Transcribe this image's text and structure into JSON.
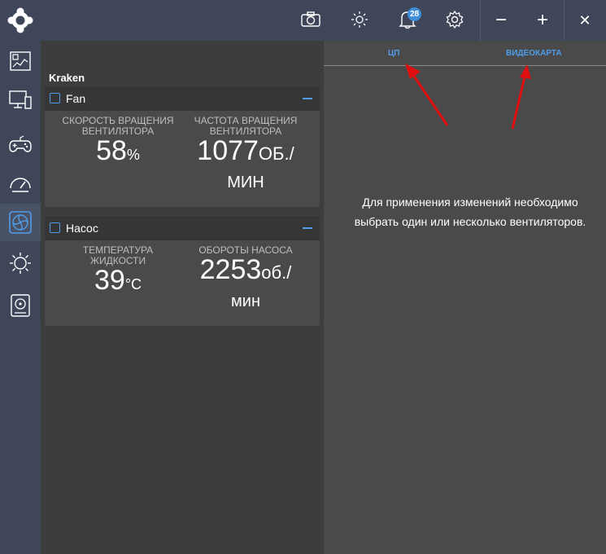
{
  "topbar": {
    "icons": [
      "camera-icon",
      "sun-icon",
      "bell-icon",
      "gear-icon"
    ],
    "notification_count": "28",
    "minimize_label": "−",
    "maximize_label": "+",
    "close_label": "✕"
  },
  "sidebar": {
    "items": [
      "dashboard-icon",
      "monitor-icon",
      "gamepad-icon",
      "speedometer-icon",
      "fan-icon",
      "lighting-icon",
      "storage-icon"
    ],
    "active_index": 4
  },
  "device": {
    "name": "Kraken",
    "fan_card": {
      "title": "Fan",
      "speed_label": "СКОРОСТЬ ВРАЩЕНИЯ ВЕНТИЛЯТОРА",
      "speed_value": "58",
      "speed_unit": "%",
      "rpm_label": "ЧАСТОТА ВРАЩЕНИЯ ВЕНТИЛЯТОРА",
      "rpm_value": "1077",
      "rpm_unit_line1": "ОБ./",
      "rpm_unit_line2": "МИН"
    },
    "pump_card": {
      "title": "Насос",
      "temp_label": "ТЕМПЕРАТУРА ЖИДКОСТИ",
      "temp_value": "39",
      "temp_unit": "°C",
      "pump_label": "ОБОРОТЫ НАСОСА",
      "pump_value": "2253",
      "pump_unit_line1": "об./",
      "pump_unit_line2": "мин"
    }
  },
  "right_panel": {
    "tabs": [
      "ЦП",
      "ВИДЕОКАРТА"
    ],
    "message": "Для применения изменений необходимо выбрать один или несколько вентиляторов."
  },
  "colors": {
    "accent": "#4f9de8",
    "annotation_arrow": "#e01010"
  }
}
